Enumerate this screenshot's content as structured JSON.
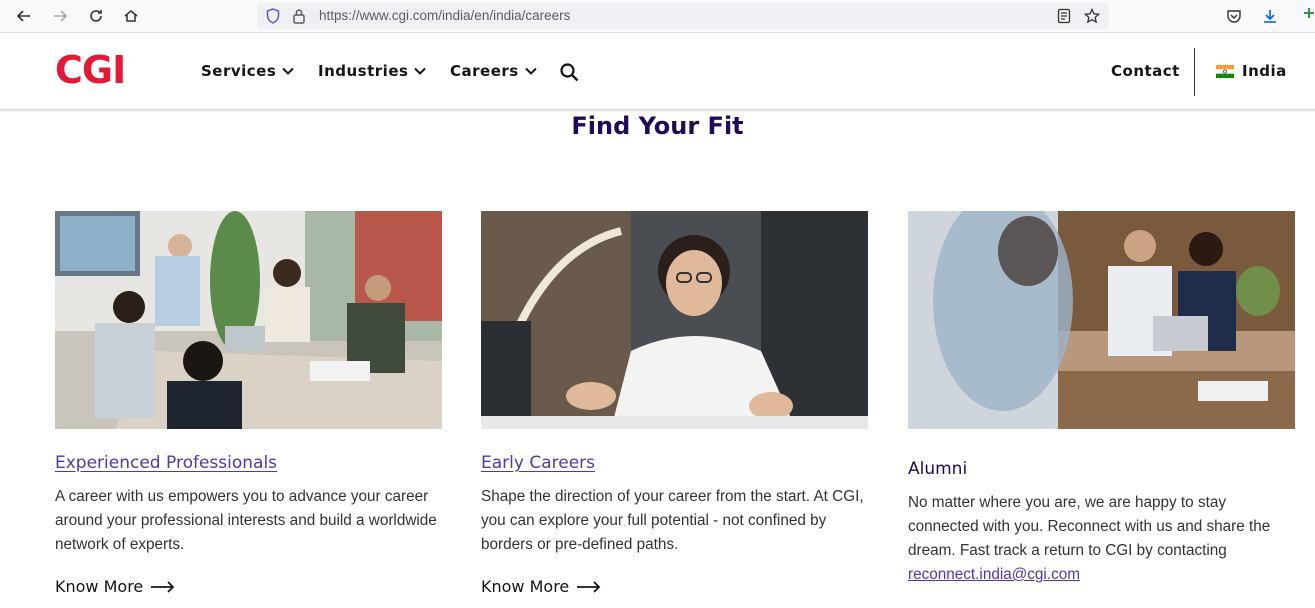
{
  "browser": {
    "url": "https://www.cgi.com/india/en/india/careers"
  },
  "header": {
    "logo": "CGI",
    "nav": [
      {
        "label": "Services"
      },
      {
        "label": "Industries"
      },
      {
        "label": "Careers"
      }
    ],
    "contact": "Contact",
    "region": "India"
  },
  "main": {
    "title": "Find Your Fit",
    "cards": [
      {
        "title": "Experienced Professionals",
        "description": "A career with us empowers you to advance your career around your professional interests and build a worldwide network of experts.",
        "cta": "Know More"
      },
      {
        "title": "Early Careers",
        "description": "Shape the direction of your career from the start. At CGI, you can explore your full potential - not confined by borders or pre-defined paths.",
        "cta": "Know More"
      },
      {
        "title": "Alumni",
        "description": "No matter where you are, we are happy to stay connected with you. Reconnect with us and share the dream. Fast track a return to CGI by contacting",
        "email": "reconnect.india@cgi.com"
      }
    ]
  },
  "colors": {
    "brand_red": "#e31937",
    "heading_navy": "#200a58",
    "link_purple": "#5236ab"
  },
  "icons": [
    "back-arrow-icon",
    "forward-arrow-icon",
    "reload-icon",
    "home-icon",
    "shield-icon",
    "lock-icon",
    "reader-icon",
    "star-icon",
    "pocket-icon",
    "download-icon",
    "search-icon",
    "chevron-down-icon",
    "india-flag-icon",
    "arrow-right-icon"
  ]
}
